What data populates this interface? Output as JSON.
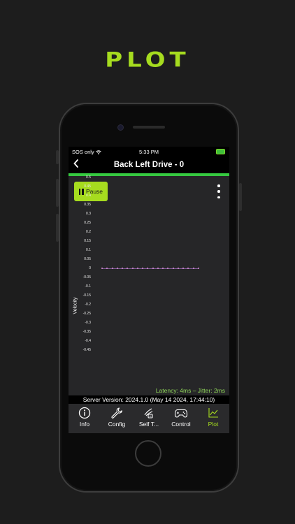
{
  "promo": {
    "title": "PLOT"
  },
  "status_bar": {
    "carrier": "SOS only",
    "time": "5:33 PM"
  },
  "nav": {
    "back_icon": "chevron-left-icon",
    "title": "Back Left Drive - 0"
  },
  "colors": {
    "accent": "#a6dc1f",
    "progress_green": "#36c940",
    "trace": "#d78ad7",
    "latency_text": "#8fd45a"
  },
  "controls": {
    "pause_label": "Pause",
    "pause_icon": "pause-icon",
    "menu_icon": "more-vertical-icon"
  },
  "chart_data": {
    "type": "line",
    "ylabel": "Velocity",
    "ylim": [
      -0.45,
      0.5
    ],
    "yticks": [
      "0.5",
      "0.45",
      "0.4",
      "0.35",
      "0.3",
      "0.25",
      "0.2",
      "0.15",
      "0.1",
      "0.05",
      "0",
      "-0.05",
      "-0.1",
      "-0.15",
      "-0.2",
      "-0.25",
      "-0.3",
      "-0.35",
      "-0.4",
      "-0.45"
    ],
    "series": [
      {
        "values": [
          0,
          0,
          0,
          0,
          0,
          0,
          0,
          0,
          0,
          0,
          0,
          0,
          0,
          0,
          0,
          0,
          0,
          0,
          0,
          0
        ]
      }
    ]
  },
  "stats": {
    "latency_text": "Latency: 4ms – Jitter: 2ms"
  },
  "footer": {
    "server_version": "Server Version:  2024.1.0 (May 14 2024, 17:44:10)"
  },
  "tabs": [
    {
      "label": "Info",
      "icon": "info-icon",
      "active": false
    },
    {
      "label": "Config",
      "icon": "wrench-icon",
      "active": false
    },
    {
      "label": "Self T...",
      "icon": "self-test-icon",
      "active": false
    },
    {
      "label": "Control",
      "icon": "gamepad-icon",
      "active": false
    },
    {
      "label": "Plot",
      "icon": "line-chart-icon",
      "active": true
    }
  ]
}
